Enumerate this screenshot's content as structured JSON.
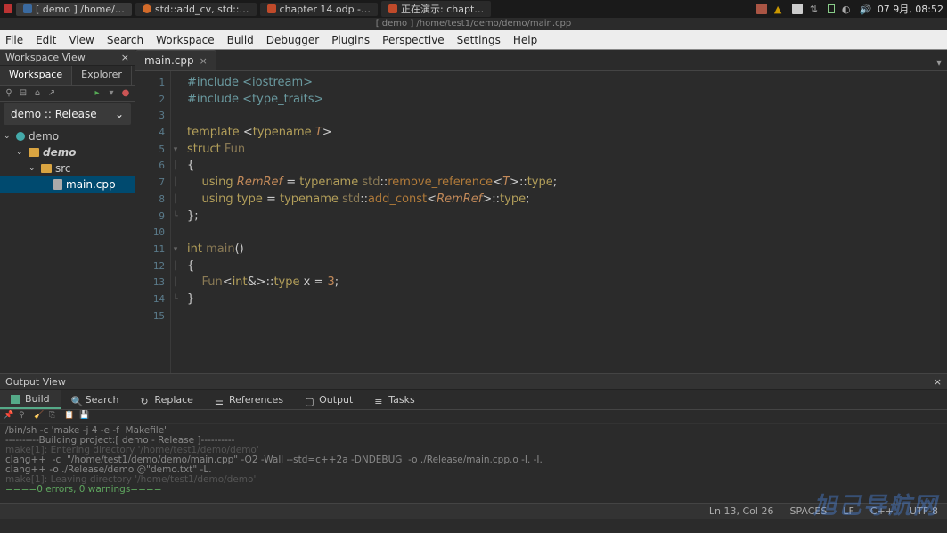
{
  "taskbar": {
    "items": [
      {
        "label": "[ demo ] /home/…",
        "color": "#3a6aa0"
      },
      {
        "label": "std::add_cv, std::…",
        "color": "#d36b2a"
      },
      {
        "label": "chapter 14.odp -…",
        "color": "#c04a2a"
      },
      {
        "label": "正在演示: chapt…",
        "color": "#c04a2a"
      }
    ],
    "clock": "07 9月, 08:52"
  },
  "titlebar": "[ demo ] /home/test1/demo/demo/main.cpp",
  "menu": [
    "File",
    "Edit",
    "View",
    "Search",
    "Workspace",
    "Build",
    "Debugger",
    "Plugins",
    "Perspective",
    "Settings",
    "Help"
  ],
  "workspace": {
    "title": "Workspace View",
    "tabs": [
      "Workspace",
      "Explorer"
    ],
    "config": "demo :: Release",
    "tree": {
      "root": "demo",
      "proj": "demo",
      "src": "src",
      "file": "main.cpp"
    }
  },
  "editor": {
    "tab": "main.cpp",
    "lines": 15,
    "code": {
      "l1": {
        "a": "#include",
        "b": "<iostream>"
      },
      "l2": {
        "a": "#include",
        "b": "<type_traits>"
      },
      "l4": {
        "a": "template",
        "b": "<",
        "c": "typename",
        "d": "T",
        "e": ">"
      },
      "l5": {
        "a": "struct",
        "b": "Fun"
      },
      "l6": "{",
      "l7": {
        "a": "using",
        "b": "RemRef",
        "c": " = ",
        "d": "typename",
        "e": "std",
        "f": "::",
        "g": "remove_reference",
        "h": "<",
        "i": "T",
        "j": ">::",
        "k": "type",
        "l": ";"
      },
      "l8": {
        "a": "using",
        "b": "type",
        "c": " = ",
        "d": "typename",
        "e": "std",
        "f": "::",
        "g": "add_const",
        "h": "<",
        "i": "RemRef",
        "j": ">::",
        "k": "type",
        "l": ";"
      },
      "l9": "};",
      "l11": {
        "a": "int",
        "b": "main",
        "c": "()"
      },
      "l12": "{",
      "l13": {
        "a": "Fun",
        "b": "<",
        "c": "int",
        "d": "&>::",
        "e": "type",
        "f": " x = ",
        "g": "3",
        "h": ";"
      },
      "l14": "}"
    }
  },
  "output": {
    "title": "Output View",
    "tabs": [
      "Build",
      "Search",
      "Replace",
      "References",
      "Output",
      "Tasks"
    ],
    "lines": [
      "/bin/sh -c 'make -j 4 -e -f  Makefile'",
      "----------Building project:[ demo - Release ]----------",
      "make[1]: Entering directory '/home/test1/demo/demo'",
      "clang++  -c  \"/home/test1/demo/demo/main.cpp\" -O2 -Wall --std=c++2a -DNDEBUG  -o ./Release/main.cpp.o -I. -I.",
      "clang++ -o ./Release/demo @\"demo.txt\" -L.",
      "make[1]: Leaving directory '/home/test1/demo/demo'",
      "====0 errors, 0 warnings===="
    ]
  },
  "statusbar": {
    "pos": "Ln 13, Col 26",
    "spaces": "SPACES",
    "eol": "LF",
    "lang": "C++",
    "enc": "UTF-8"
  },
  "watermark": "旭己导航网"
}
